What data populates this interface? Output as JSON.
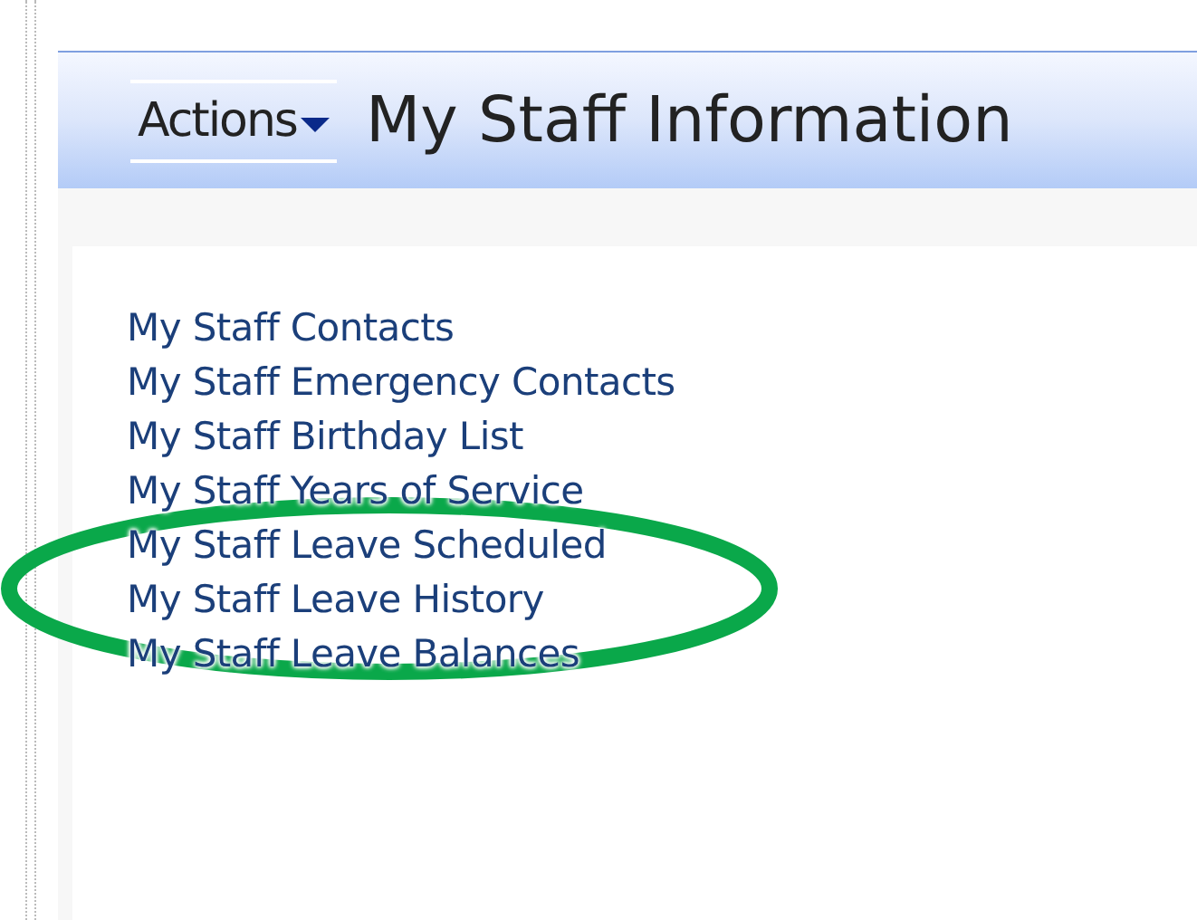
{
  "header": {
    "actions_label": "Actions",
    "title": "My Staff Information"
  },
  "links": [
    {
      "label": "My Staff Contacts",
      "circled": false
    },
    {
      "label": "My Staff Emergency Contacts",
      "circled": false
    },
    {
      "label": "My Staff Birthday List",
      "circled": false
    },
    {
      "label": "My Staff Years of Service",
      "circled": false
    },
    {
      "label": "My Staff Leave Scheduled",
      "circled": true
    },
    {
      "label": "My Staff Leave History",
      "circled": true
    },
    {
      "label": "My Staff Leave Balances",
      "circled": false
    }
  ]
}
